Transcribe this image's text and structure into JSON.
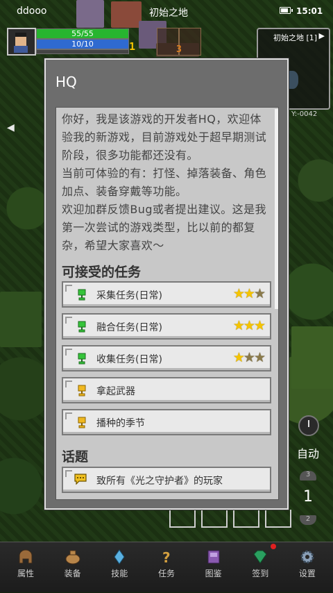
{
  "status_bar": {
    "user": "ddooo",
    "map": "初始之地",
    "time": "15:01"
  },
  "player": {
    "hp": "55/55",
    "mp": "10/10",
    "level_a": "1",
    "level_b": "3"
  },
  "minimap": {
    "title": "初始之地 [1]",
    "arrow": "▶",
    "coord": "Y:-0042"
  },
  "dialog": {
    "title": "HQ",
    "intro": "你好，我是该游戏的开发者HQ，欢迎体验我的新游戏，目前游戏处于超早期测试阶段，很多功能都还没有。\n当前可体验的有：打怪、掉落装备、角色加点、装备穿戴等功能。\n欢迎加群反馈Bug或者提出建议。这是我第一次尝试的游戏类型，比以前的都复杂，希望大家喜欢～",
    "quests_title": "可接受的任务",
    "quests": [
      {
        "label": "采集任务(日常)",
        "cup": "green",
        "stars": [
          true,
          true,
          false
        ]
      },
      {
        "label": "融合任务(日常)",
        "cup": "green",
        "stars": [
          true,
          true,
          true
        ]
      },
      {
        "label": "收集任务(日常)",
        "cup": "green",
        "stars": [
          true,
          false,
          false
        ]
      },
      {
        "label": "拿起武器",
        "cup": "gold",
        "stars": []
      },
      {
        "label": "播种的季节",
        "cup": "gold",
        "stars": []
      }
    ],
    "topics_title": "话题",
    "topics": [
      {
        "label": "致所有《光之守护者》的玩家"
      }
    ]
  },
  "controls": {
    "auto": "自动",
    "speed": "1",
    "speed_up": "3",
    "speed_down": "2"
  },
  "nav": [
    {
      "label": "属性",
      "icon": "helmet-icon",
      "color": "#9a6a3a"
    },
    {
      "label": "装备",
      "icon": "bag-icon",
      "color": "#b8864a"
    },
    {
      "label": "技能",
      "icon": "crystal-icon",
      "color": "#5ab0e0"
    },
    {
      "label": "任务",
      "icon": "question-icon",
      "color": "#d4a040"
    },
    {
      "label": "图鉴",
      "icon": "book-icon",
      "color": "#8a5ab0"
    },
    {
      "label": "签到",
      "icon": "gem-icon",
      "color": "#2aa060"
    },
    {
      "label": "设置",
      "icon": "gear-icon",
      "color": "#8aa0b8"
    }
  ]
}
